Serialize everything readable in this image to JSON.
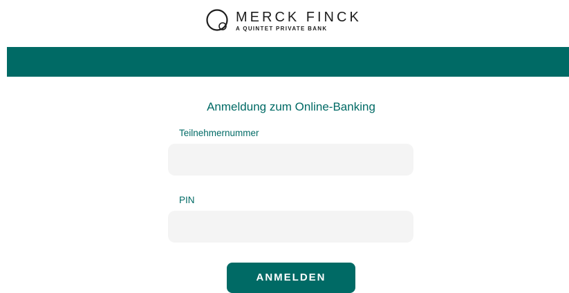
{
  "header": {
    "logo": {
      "name": "MERCK FINCK",
      "tagline": "A QUINTET PRIVATE BANK",
      "icon": "merck-finck-ring-mark"
    }
  },
  "colors": {
    "brand": "#006a65",
    "input_background": "#f4f4f4",
    "page_background": "#ffffff"
  },
  "login": {
    "title": "Anmeldung zum Online-Banking",
    "user_field": {
      "label": "Teilnehmernummer",
      "value": "",
      "placeholder": ""
    },
    "pin_field": {
      "label": "PIN",
      "value": "",
      "placeholder": ""
    },
    "submit_label": "ANMELDEN"
  }
}
